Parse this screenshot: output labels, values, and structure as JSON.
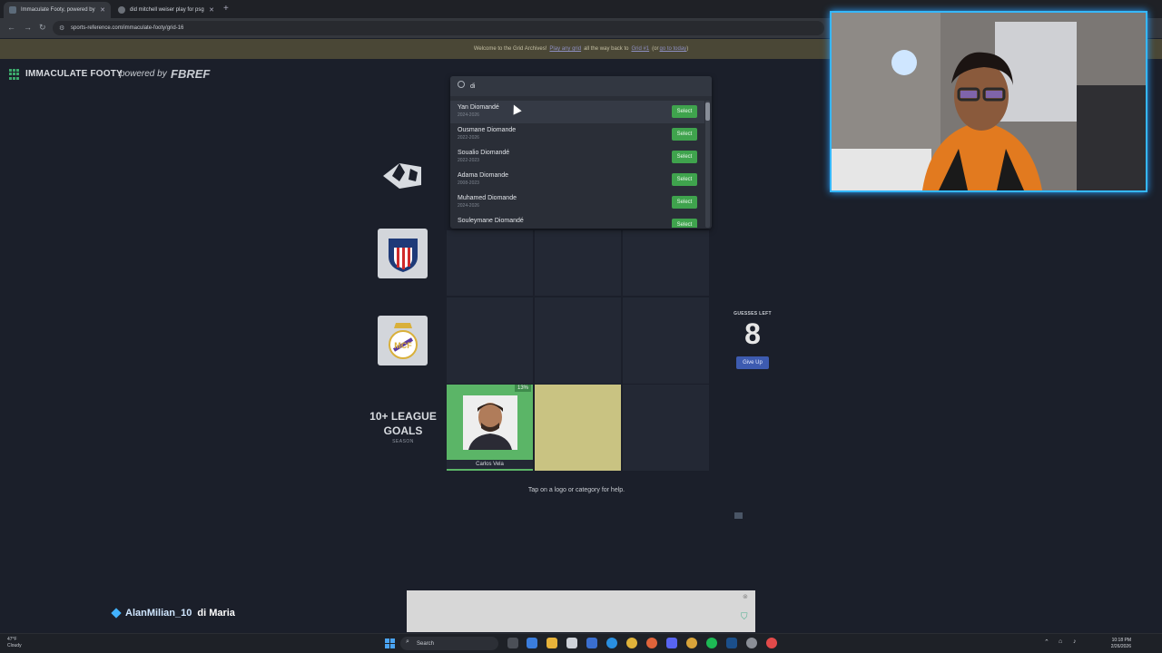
{
  "browser": {
    "tabs": [
      {
        "label": "Immaculate Footy, powered by"
      },
      {
        "label": "did mitchell weiser play for psg"
      }
    ],
    "url": "sports-reference.com/immaculate-footy/grid-16"
  },
  "banner": {
    "text_before": "Welcome to the Grid Archives!",
    "link1": "Play any grid",
    "text_mid": "all the way back to",
    "link2": "Grid #1",
    "text_or": "(or",
    "link3": "go to today",
    "text_end": ")"
  },
  "site": {
    "title": "IMMACULATE FOOTY",
    "powered": "powered by",
    "brand": "FBREF"
  },
  "grid": {
    "row_category": "10+ LEAGUE GOALS",
    "row_category_sub": "SEASON",
    "correct_cell": {
      "percent": "13%",
      "player": "Carlos Vela"
    },
    "guesses_label": "GUESSES LEFT",
    "guesses_left": "8",
    "give_up": "Give Up",
    "help": "Tap on a logo or category for help."
  },
  "search": {
    "query": "di",
    "select_label": "Select",
    "results": [
      {
        "name": "Yan Diomandé",
        "years": "2024-2026"
      },
      {
        "name": "Ousmane Diomande",
        "years": "2022-2026"
      },
      {
        "name": "Soualio Diomandé",
        "years": "2022-2023"
      },
      {
        "name": "Adama Diomande",
        "years": "2008-2023"
      },
      {
        "name": "Muhamed Diomande",
        "years": "2024-2026"
      },
      {
        "name": "Souleymane Diomandé",
        "years": ""
      }
    ]
  },
  "overlay": {
    "chat_user": "AlanMilian_10",
    "chat_message": "di Maria"
  },
  "taskbar": {
    "weather_temp": "47°F",
    "weather_desc": "Cloudy",
    "search": "Search",
    "time": "10:18 PM",
    "date": "2/26/2026"
  }
}
